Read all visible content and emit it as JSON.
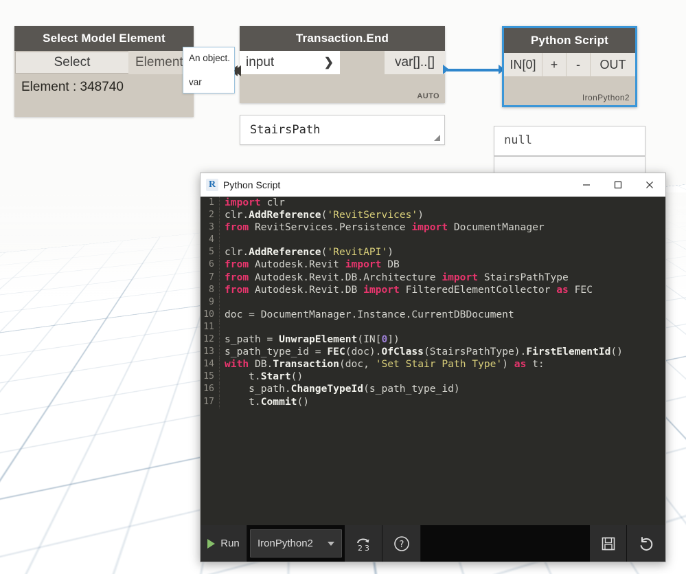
{
  "viewport": {
    "name": "dynamo-3d-background"
  },
  "nodes": {
    "select_model_element": {
      "title": "Select Model Element",
      "select_button": "Select",
      "output_port": "Element",
      "value": "Element : 348740"
    },
    "transaction_end": {
      "title": "Transaction.End",
      "input_port": "input",
      "input_caret": "❯",
      "output_port": "var[]..[]",
      "tag": "AUTO",
      "preview_value": "StairsPath"
    },
    "python_script": {
      "title": "Python Script",
      "in_port": "IN[0]",
      "plus": "+",
      "minus": "-",
      "out_port": "OUT",
      "engine_tag": "IronPython2",
      "preview_value": "null"
    }
  },
  "tooltip": {
    "line1": "An object.",
    "line2": "var"
  },
  "dialog": {
    "icon": "revit-r-icon",
    "icon_glyph": "R",
    "title": "Python Script",
    "window_controls": {
      "minimize": "—",
      "maximize": "☐",
      "close": "✕"
    },
    "code_lines": [
      {
        "n": "1",
        "tokens": [
          {
            "t": "import",
            "c": "kw"
          },
          {
            "t": " clr",
            "c": "plain"
          }
        ]
      },
      {
        "n": "2",
        "tokens": [
          {
            "t": "clr.",
            "c": "plain"
          },
          {
            "t": "AddReference",
            "c": "fn"
          },
          {
            "t": "(",
            "c": "plain"
          },
          {
            "t": "'RevitServices'",
            "c": "str"
          },
          {
            "t": ")",
            "c": "plain"
          }
        ]
      },
      {
        "n": "3",
        "tokens": [
          {
            "t": "from",
            "c": "kw"
          },
          {
            "t": " RevitServices.Persistence ",
            "c": "plain"
          },
          {
            "t": "import",
            "c": "kw"
          },
          {
            "t": " DocumentManager",
            "c": "plain"
          }
        ]
      },
      {
        "n": "4",
        "tokens": [
          {
            "t": "",
            "c": "plain"
          }
        ]
      },
      {
        "n": "5",
        "tokens": [
          {
            "t": "clr.",
            "c": "plain"
          },
          {
            "t": "AddReference",
            "c": "fn"
          },
          {
            "t": "(",
            "c": "plain"
          },
          {
            "t": "'RevitAPI'",
            "c": "str"
          },
          {
            "t": ")",
            "c": "plain"
          }
        ]
      },
      {
        "n": "6",
        "tokens": [
          {
            "t": "from",
            "c": "kw"
          },
          {
            "t": " Autodesk.Revit ",
            "c": "plain"
          },
          {
            "t": "import",
            "c": "kw"
          },
          {
            "t": " DB",
            "c": "plain"
          }
        ]
      },
      {
        "n": "7",
        "tokens": [
          {
            "t": "from",
            "c": "kw"
          },
          {
            "t": " Autodesk.Revit.DB.Architecture ",
            "c": "plain"
          },
          {
            "t": "import",
            "c": "kw"
          },
          {
            "t": " StairsPathType",
            "c": "plain"
          }
        ]
      },
      {
        "n": "8",
        "tokens": [
          {
            "t": "from",
            "c": "kw"
          },
          {
            "t": " Autodesk.Revit.DB ",
            "c": "plain"
          },
          {
            "t": "import",
            "c": "kw"
          },
          {
            "t": " FilteredElementCollector ",
            "c": "plain"
          },
          {
            "t": "as",
            "c": "kw"
          },
          {
            "t": " FEC",
            "c": "plain"
          }
        ]
      },
      {
        "n": "9",
        "tokens": [
          {
            "t": "",
            "c": "plain"
          }
        ]
      },
      {
        "n": "10",
        "tokens": [
          {
            "t": "doc = DocumentManager.Instance.CurrentDBDocument",
            "c": "plain"
          }
        ]
      },
      {
        "n": "11",
        "tokens": [
          {
            "t": "",
            "c": "plain"
          }
        ]
      },
      {
        "n": "12",
        "tokens": [
          {
            "t": "s_path = ",
            "c": "plain"
          },
          {
            "t": "UnwrapElement",
            "c": "fn"
          },
          {
            "t": "(IN[",
            "c": "plain"
          },
          {
            "t": "0",
            "c": "num"
          },
          {
            "t": "])",
            "c": "plain"
          }
        ]
      },
      {
        "n": "13",
        "tokens": [
          {
            "t": "s_path_type_id = ",
            "c": "plain"
          },
          {
            "t": "FEC",
            "c": "fn"
          },
          {
            "t": "(doc).",
            "c": "plain"
          },
          {
            "t": "OfClass",
            "c": "fn"
          },
          {
            "t": "(StairsPathType).",
            "c": "plain"
          },
          {
            "t": "FirstElementId",
            "c": "fn"
          },
          {
            "t": "()",
            "c": "plain"
          }
        ]
      },
      {
        "n": "14",
        "tokens": [
          {
            "t": "with",
            "c": "kw"
          },
          {
            "t": " DB.",
            "c": "plain"
          },
          {
            "t": "Transaction",
            "c": "fn"
          },
          {
            "t": "(doc, ",
            "c": "plain"
          },
          {
            "t": "'Set Stair Path Type'",
            "c": "str"
          },
          {
            "t": ") ",
            "c": "plain"
          },
          {
            "t": "as",
            "c": "kw"
          },
          {
            "t": " t:",
            "c": "plain"
          }
        ]
      },
      {
        "n": "15",
        "tokens": [
          {
            "t": "    t.",
            "c": "plain"
          },
          {
            "t": "Start",
            "c": "fn"
          },
          {
            "t": "()",
            "c": "plain"
          }
        ]
      },
      {
        "n": "16",
        "tokens": [
          {
            "t": "    s_path.",
            "c": "plain"
          },
          {
            "t": "ChangeTypeId",
            "c": "fn"
          },
          {
            "t": "(s_path_type_id)",
            "c": "plain"
          }
        ]
      },
      {
        "n": "17",
        "tokens": [
          {
            "t": "    t.",
            "c": "plain"
          },
          {
            "t": "Commit",
            "c": "fn"
          },
          {
            "t": "()",
            "c": "plain"
          }
        ]
      }
    ],
    "toolbar": {
      "run_label": "Run",
      "engine_value": "IronPython2",
      "migrate_label": "2to3-migrate-icon",
      "help_label": "help-icon",
      "save_label": "save-icon",
      "revert_label": "revert-icon"
    }
  },
  "colors": {
    "node_header": "#595652",
    "node_body": "#cfc9bf",
    "node_port": "#e9e6e1",
    "selection_blue": "#3a96d8",
    "wire_blue": "#2f86cc",
    "editor_bg": "#2b2b28",
    "toolbar_bg": "#0a0a0a",
    "keyword_pink": "#e8356d",
    "string_yellow": "#d9cf7a",
    "number_purple": "#9c7fd4",
    "run_green": "#86bf6a",
    "axis_red": "#e04a4a"
  }
}
